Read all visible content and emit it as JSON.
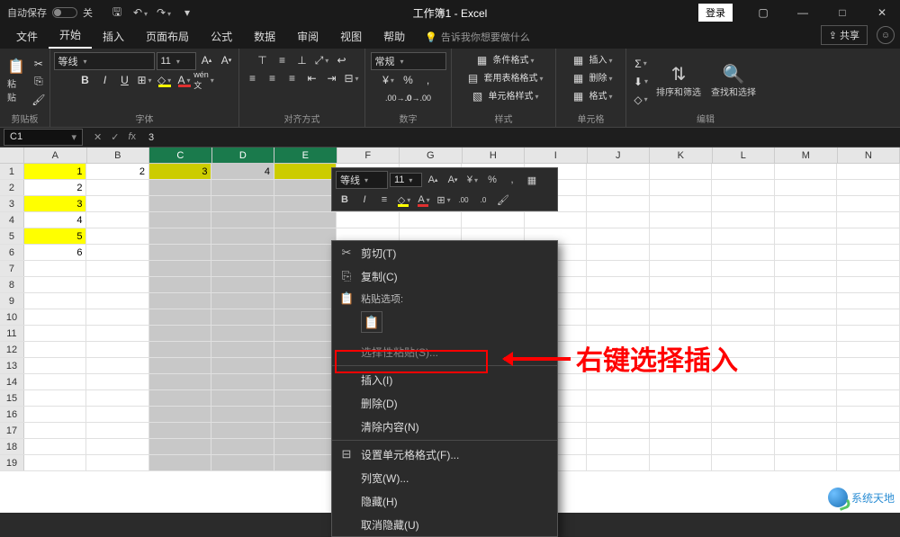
{
  "titlebar": {
    "autosave": "自动保存",
    "toggle_off": "关",
    "title": "工作簿1 - Excel",
    "login": "登录"
  },
  "tabs": {
    "file": "文件",
    "home": "开始",
    "insert": "插入",
    "layout": "页面布局",
    "formulas": "公式",
    "data": "数据",
    "review": "审阅",
    "view": "视图",
    "help": "帮助",
    "tellme": "告诉我你想要做什么",
    "share": "共享"
  },
  "ribbon": {
    "clipboard": {
      "paste": "粘贴",
      "label": "剪贴板"
    },
    "font": {
      "name": "等线",
      "size": "11",
      "label": "字体"
    },
    "align": {
      "label": "对齐方式"
    },
    "number": {
      "format": "常规",
      "label": "数字"
    },
    "styles": {
      "cond": "条件格式",
      "table": "套用表格格式",
      "cell": "单元格样式",
      "label": "样式"
    },
    "cells": {
      "insert": "插入",
      "delete": "删除",
      "format": "格式",
      "label": "单元格"
    },
    "editing": {
      "sort": "排序和筛选",
      "find": "查找和选择",
      "label": "编辑"
    }
  },
  "fbar": {
    "name": "C1",
    "value": "3"
  },
  "cols": [
    "A",
    "B",
    "C",
    "D",
    "E",
    "F",
    "G",
    "H",
    "I",
    "J",
    "K",
    "L",
    "M",
    "N"
  ],
  "sel_cols": [
    "C",
    "D",
    "E"
  ],
  "sheet_data": {
    "A1": "1",
    "B1": "2",
    "C1": "3",
    "D1": "4",
    "A2": "2",
    "A3": "3",
    "A4": "4",
    "A5": "5",
    "A6": "6"
  },
  "highlight_cells": [
    "A1",
    "C1",
    "E1",
    "A3",
    "A5"
  ],
  "row_count": 19,
  "minibar": {
    "font": "等线",
    "size": "11"
  },
  "ctxmenu": {
    "cut": "剪切(T)",
    "copy": "复制(C)",
    "paste_opts": "粘贴选项:",
    "paste_special": "选择性粘贴(S)...",
    "insert": "插入(I)",
    "delete": "删除(D)",
    "clear": "清除内容(N)",
    "format_cells": "设置单元格格式(F)...",
    "col_width": "列宽(W)...",
    "hide": "隐藏(H)",
    "unhide": "取消隐藏(U)"
  },
  "annotation": "右键选择插入",
  "watermark": "系统天地"
}
